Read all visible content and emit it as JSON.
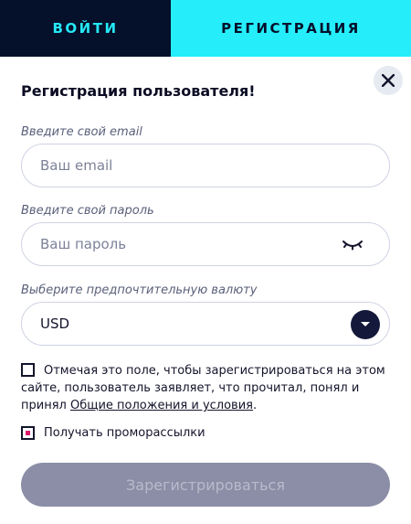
{
  "tabs": {
    "login": "ВОЙТИ",
    "register": "РЕГИСТРАЦИЯ"
  },
  "form": {
    "title": "Регистрация пользователя!",
    "email_label": "Введите свой email",
    "email_placeholder": "Ваш email",
    "email_value": "",
    "password_label": "Введите свой пароль",
    "password_placeholder": "Ваш пароль",
    "password_value": "",
    "currency_label": "Выберите предпочтительную валюту",
    "currency_value": "USD",
    "terms_text": "Отмечая это поле, чтобы зарегистрироваться на этом сайте, пользователь заявляет, что прочитал, понял и принял ",
    "terms_link": "Общие положения и условия",
    "terms_end": ".",
    "terms_checked": false,
    "promo_label": "Получать проморассылки",
    "promo_checked": true,
    "submit_label": "Зарегистрироваться"
  },
  "icons": {
    "close": "close-icon",
    "eye": "eye-closed-icon",
    "dropdown": "chevron-down-icon"
  },
  "colors": {
    "tab_login_bg": "#05102b",
    "tab_register_bg": "#25eefa",
    "accent_cyan": "#25e8f5",
    "promo_check": "#e0186c",
    "submit_bg": "#8b8ea6"
  }
}
